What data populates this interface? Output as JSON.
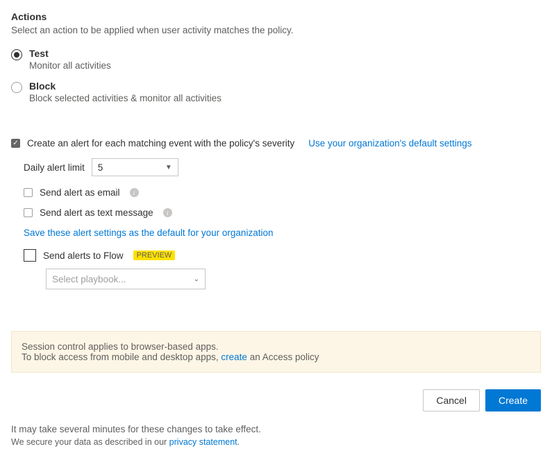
{
  "header": {
    "title": "Actions",
    "description": "Select an action to be applied when user activity matches the policy."
  },
  "radios": {
    "test": {
      "label": "Test",
      "sub": "Monitor all activities"
    },
    "block": {
      "label": "Block",
      "sub": "Block selected activities & monitor all activities"
    }
  },
  "alert": {
    "create_label": "Create an alert for each matching event with the policy's severity",
    "use_default_link": "Use your organization's default settings",
    "daily_limit_label": "Daily alert limit",
    "daily_limit_value": "5",
    "send_email": "Send alert as email",
    "send_sms": "Send alert as text message",
    "save_default_link": "Save these alert settings as the default for your organization",
    "send_flow": "Send alerts to Flow",
    "preview_badge": "PREVIEW",
    "playbook_placeholder": "Select playbook..."
  },
  "banner": {
    "line1": "Session control applies to browser-based apps.",
    "line2a": "To block access from mobile and desktop apps, ",
    "line2_link": "create",
    "line2b": " an Access policy"
  },
  "buttons": {
    "cancel": "Cancel",
    "create": "Create"
  },
  "footer": {
    "line1": "It may take several minutes for these changes to take effect.",
    "line2a": "We secure your data as described in our ",
    "line2_link": "privacy statement",
    "line2b": "."
  }
}
